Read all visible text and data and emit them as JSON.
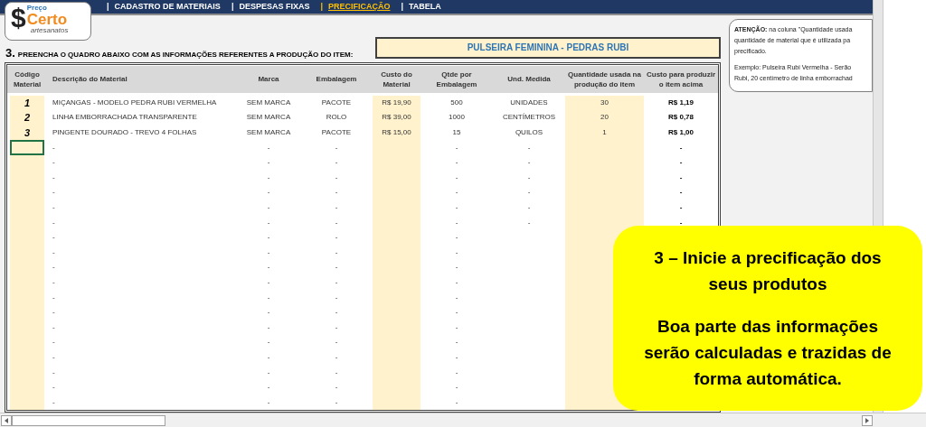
{
  "logo": {
    "symbol": "$",
    "top": "Preço",
    "main": "Certo",
    "sub": "artesanatos"
  },
  "nav": {
    "tabs": [
      {
        "separator": "|",
        "label": "CADASTRO DE MATERIAIS",
        "selected": false
      },
      {
        "separator": "|",
        "label": "DESPESAS FIXAS",
        "selected": false
      },
      {
        "separator": "|",
        "label": "PRECIFICAÇÃO",
        "selected": true
      },
      {
        "separator": "|",
        "label": "TABELA",
        "selected": false
      }
    ]
  },
  "section": {
    "number": "3.",
    "title": "PREENCHA O QUADRO ABAIXO COM AS INFORMAÇÕES REFERENTES A PRODUÇÃO DO ITEM:",
    "product": "PULSEIRA FEMININA - PEDRAS RUBI"
  },
  "table": {
    "columns": [
      "Código Material",
      "Descrição do Material",
      "Marca",
      "Embalagem",
      "Custo do Material",
      "Qtde por Embalagem",
      "Und. Medida",
      "Quantidade usada na produção do item",
      "Custo para produzir o item acima"
    ],
    "rows": [
      {
        "selected": false,
        "cells": [
          "1",
          "MIÇANGAS - MODELO PEDRA RUBI VERMELHA",
          "SEM MARCA",
          "PACOTE",
          "R$ 19,90",
          "500",
          "UNIDADES",
          "30",
          "R$ 1,19"
        ]
      },
      {
        "selected": false,
        "cells": [
          "2",
          "LINHA EMBORRACHADA TRANSPARENTE",
          "SEM MARCA",
          "ROLO",
          "R$ 39,00",
          "1000",
          "CENTÍMETROS",
          "20",
          "R$ 0,78"
        ]
      },
      {
        "selected": false,
        "cells": [
          "3",
          "PINGENTE DOURADO - TREVO 4 FOLHAS",
          "SEM MARCA",
          "PACOTE",
          "R$ 15,00",
          "15",
          "QUILOS",
          "1",
          "R$ 1,00"
        ]
      },
      {
        "selected": true,
        "cells": [
          null,
          "-",
          "-",
          "-",
          null,
          "-",
          "-",
          null,
          "-"
        ]
      },
      {
        "selected": false,
        "cells": [
          null,
          "-",
          "-",
          "-",
          null,
          "-",
          "-",
          null,
          "-"
        ]
      },
      {
        "selected": false,
        "cells": [
          null,
          "-",
          "-",
          "-",
          null,
          "-",
          "-",
          null,
          "-"
        ]
      },
      {
        "selected": false,
        "cells": [
          null,
          "-",
          "-",
          "-",
          null,
          "-",
          "-",
          null,
          "-"
        ]
      },
      {
        "selected": false,
        "cells": [
          null,
          "-",
          "-",
          "-",
          null,
          "-",
          "-",
          null,
          "-"
        ]
      },
      {
        "selected": false,
        "cells": [
          null,
          "-",
          "-",
          "-",
          null,
          "-",
          "-",
          null,
          "-"
        ]
      },
      {
        "selected": false,
        "cells": [
          null,
          "-",
          "-",
          "-",
          null,
          "-",
          null,
          null,
          null
        ]
      },
      {
        "selected": false,
        "cells": [
          null,
          "-",
          "-",
          "-",
          null,
          "-",
          null,
          null,
          null
        ]
      },
      {
        "selected": false,
        "cells": [
          null,
          "-",
          "-",
          "-",
          null,
          "-",
          null,
          null,
          null
        ]
      },
      {
        "selected": false,
        "cells": [
          null,
          "-",
          "-",
          "-",
          null,
          "-",
          null,
          null,
          null
        ]
      },
      {
        "selected": false,
        "cells": [
          null,
          "-",
          "-",
          "-",
          null,
          "-",
          null,
          null,
          null
        ]
      },
      {
        "selected": false,
        "cells": [
          null,
          "-",
          "-",
          "-",
          null,
          "-",
          null,
          null,
          null
        ]
      },
      {
        "selected": false,
        "cells": [
          null,
          "-",
          "-",
          "-",
          null,
          "-",
          null,
          null,
          null
        ]
      },
      {
        "selected": false,
        "cells": [
          null,
          "-",
          "-",
          "-",
          null,
          "-",
          null,
          null,
          null
        ]
      },
      {
        "selected": false,
        "cells": [
          null,
          "-",
          "-",
          "-",
          null,
          "-",
          null,
          null,
          null
        ]
      },
      {
        "selected": false,
        "cells": [
          null,
          "-",
          "-",
          "-",
          null,
          "-",
          null,
          null,
          null
        ]
      },
      {
        "selected": false,
        "cells": [
          null,
          "-",
          "-",
          "-",
          null,
          "-",
          null,
          null,
          null
        ]
      },
      {
        "selected": false,
        "cells": [
          null,
          "-",
          "-",
          "-",
          null,
          "-",
          null,
          null,
          null
        ]
      }
    ]
  },
  "note": {
    "lines": [
      "**ATENÇÃO:**  na coluna \"Quantidade usada",
      "quantidade de material que é utilizada pa",
      "precificado.",
      "Exemplo: Pulseira Rubi Vermelha - Serão",
      "Rubi, 20 centímetro de linha emborrachad"
    ]
  },
  "callout": {
    "title": "3 – Inicie a precificação dos seus produtos",
    "body": "Boa parte das informações serão calculadas e trazidas de forma automática."
  }
}
